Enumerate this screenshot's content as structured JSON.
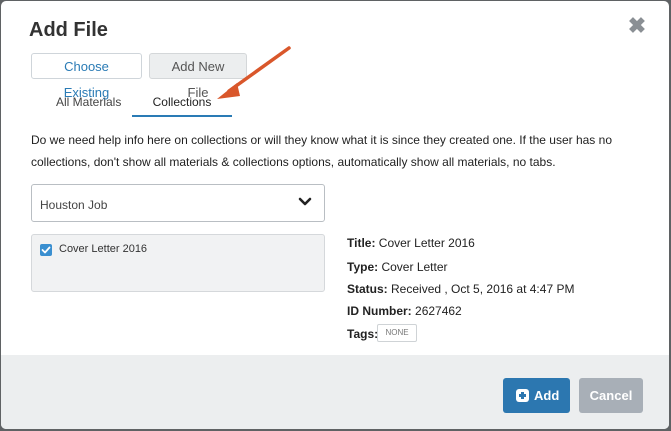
{
  "dialog": {
    "title": "Add File",
    "close_glyph": "✖"
  },
  "source_tabs": [
    {
      "label": "Choose Existing",
      "active": true
    },
    {
      "label": "Add New File",
      "active": false
    }
  ],
  "sub_tabs": [
    {
      "label": "All Materials",
      "active": false
    },
    {
      "label": "Collections",
      "active": true
    }
  ],
  "help_text": "Do we need help info here on collections or will they know what it is since they created one. If the user has no collections, don't show all materials & collections options, automatically show all materials, no tabs.",
  "collection_select": {
    "value": "Houston Job",
    "icon": "chevron-down-icon"
  },
  "file_list": [
    {
      "label": "Cover Letter 2016",
      "checked": true
    }
  ],
  "details": {
    "title_label": "Title:",
    "title_value": "Cover Letter 2016",
    "type_label": "Type:",
    "type_value": "Cover Letter",
    "status_label": "Status:",
    "status_value": "Received , Oct 5, 2016 at 4:47 PM",
    "id_label": "ID Number:",
    "id_value": "2627462",
    "tags_label": "Tags:",
    "tags_value": "NONE"
  },
  "footer": {
    "add_label": "Add",
    "cancel_label": "Cancel"
  },
  "colors": {
    "accent": "#2c77b0",
    "annotation_arrow": "#d9572b",
    "cancel": "#a8afb7"
  }
}
